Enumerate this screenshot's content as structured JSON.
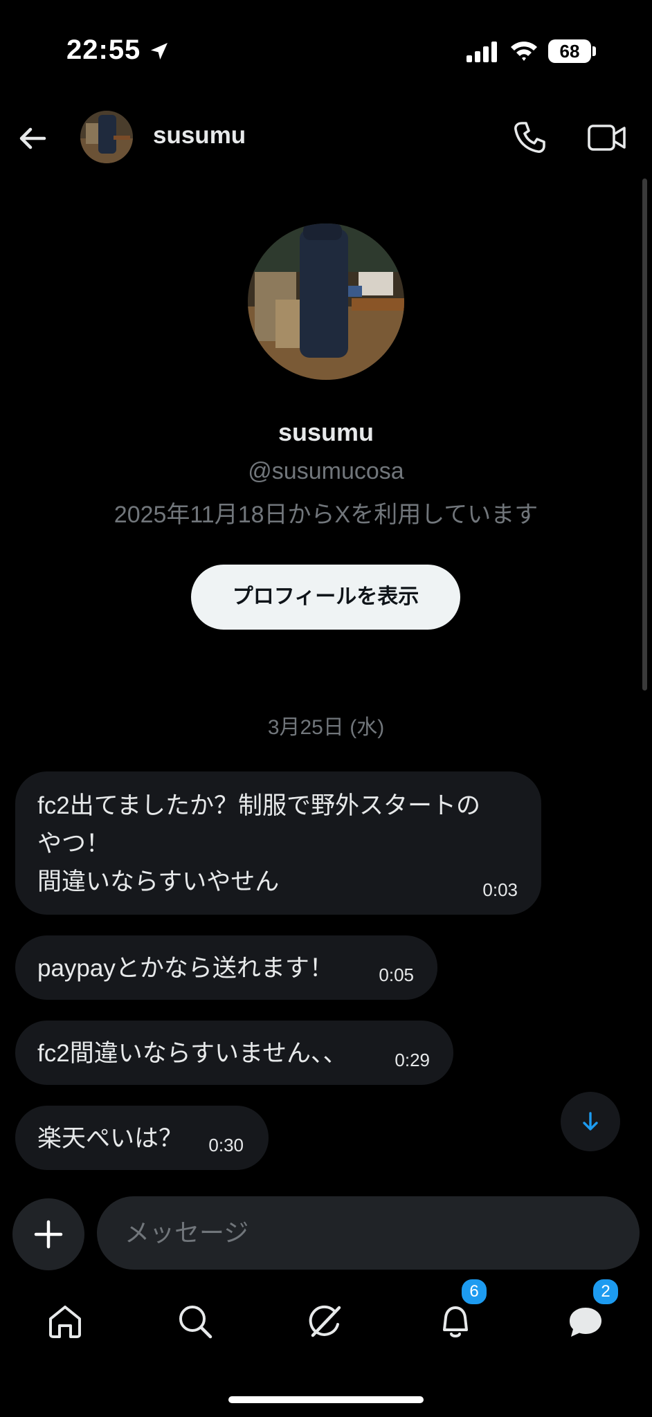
{
  "status_bar": {
    "time": "22:55",
    "battery": "68"
  },
  "header": {
    "name": "susumu"
  },
  "profile": {
    "name": "susumu",
    "handle": "@susumucosa",
    "joined": "2025年11月18日からXを利用しています",
    "view_profile_label": "プロフィールを表示"
  },
  "date_separator": "3月25日 (水)",
  "messages": [
    {
      "text": "fc2出てましたか？制服で野外スタートの\nやつ！\n間違いならすいやせん",
      "time": "0:03"
    },
    {
      "text": "paypayとかなら送れます！",
      "time": "0:05"
    },
    {
      "text": "fc2間違いならすいません、、",
      "time": "0:29"
    },
    {
      "text": "楽天ぺいは？",
      "time": "0:30"
    }
  ],
  "composer": {
    "placeholder": "メッセージ",
    "value": ""
  },
  "nav": {
    "items": [
      "home-icon",
      "search-icon",
      "grok-icon",
      "bell-icon",
      "messages-icon"
    ],
    "notifications_badge": "6",
    "messages_badge": "2"
  },
  "colors": {
    "accent": "#1d9bf0",
    "bubble": "#16181c",
    "muted": "#71767b"
  }
}
